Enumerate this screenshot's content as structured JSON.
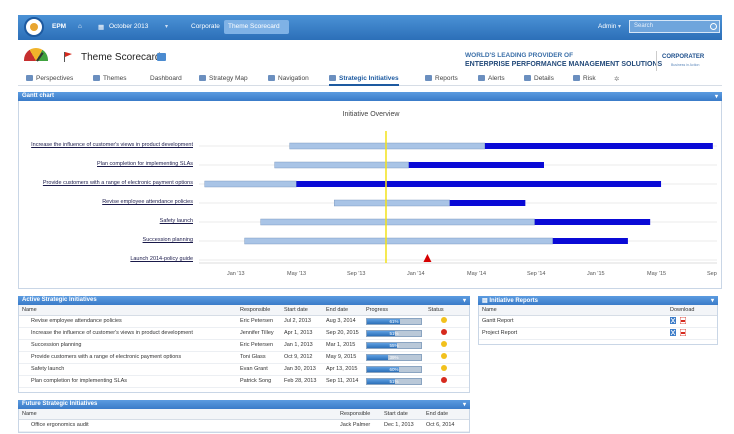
{
  "topbar": {
    "app": "EPM",
    "period": "October 2013",
    "org": "Corporate",
    "view": "Theme Scorecard",
    "user": "Admin",
    "search_placeholder": "Search"
  },
  "header": {
    "title": "Theme Scorecard",
    "banner_line1": "WORLD'S LEADING PROVIDER OF",
    "banner_line2": "ENTERPRISE PERFORMANCE MANAGEMENT SOLUTIONS",
    "logo_main": "CORPORATER",
    "logo_sub": "Business in Action"
  },
  "nav": {
    "tabs": [
      {
        "label": "Perspectives",
        "icon": "perspectives-icon"
      },
      {
        "label": "Themes",
        "icon": "themes-icon"
      },
      {
        "label": "Dashboard",
        "icon": ""
      },
      {
        "label": "Strategy Map",
        "icon": "strategy-map-icon"
      },
      {
        "label": "Navigation",
        "icon": "navigation-icon"
      },
      {
        "label": "Strategic Initiatives",
        "icon": "list-icon",
        "active": true
      },
      {
        "label": "Reports",
        "icon": "reports-icon"
      },
      {
        "label": "Alerts",
        "icon": "alert-icon"
      },
      {
        "label": "Details",
        "icon": "details-icon"
      },
      {
        "label": "Risk",
        "icon": "risk-icon"
      }
    ]
  },
  "gantt": {
    "panel_title": "Gantt chart",
    "subtitle": "Initiative Overview",
    "rows": [
      {
        "label": "Increase the influence of customer's views in product development",
        "start": 0.175,
        "split": 0.552,
        "end": 0.992
      },
      {
        "label": "Plan completion for implementing SLAs",
        "start": 0.146,
        "split": 0.405,
        "end": 0.666
      },
      {
        "label": "Provide customers with a range of electronic payment options",
        "start": 0.011,
        "split": 0.188,
        "end": 0.892
      },
      {
        "label": "Revise employee attendance policies",
        "start": 0.261,
        "split": 0.484,
        "end": 0.63
      },
      {
        "label": "Safety launch",
        "start": 0.119,
        "split": 0.648,
        "end": 0.871
      },
      {
        "label": "Succession planning",
        "start": 0.088,
        "split": 0.683,
        "end": 0.828
      },
      {
        "label": "Launch 2014-policy guide",
        "milestone": 0.441
      }
    ],
    "today": 0.361,
    "ticks": [
      "Jan '13",
      "May '13",
      "Sep '13",
      "Jan '14",
      "May '14",
      "Sep '14",
      "Jan '15",
      "May '15",
      "Sep"
    ]
  },
  "active": {
    "panel_title": "Active Strategic Initiatives",
    "columns": [
      "Name",
      "Responsible",
      "Start date",
      "End date",
      "Progress",
      "Status"
    ],
    "rows": [
      {
        "name": "Revise employee attendance policies",
        "resp": "Eric Petersen",
        "start": "Jul 2, 2013",
        "end": "Aug 3, 2014",
        "progress": 0.61,
        "ptext": "61%",
        "status": "yellow"
      },
      {
        "name": "Increase the influence of customer's views in product development",
        "resp": "Jennifer Tilley",
        "start": "Apr 1, 2013",
        "end": "Sep 20, 2015",
        "progress": 0.51,
        "ptext": "51%",
        "status": "red"
      },
      {
        "name": "Succession planning",
        "resp": "Eric Petersen",
        "start": "Jan 1, 2013",
        "end": "Mar 1, 2015",
        "progress": 0.55,
        "ptext": "55%",
        "status": "yellow"
      },
      {
        "name": "Provide customers with a range of electronic payment options",
        "resp": "Toni Glass",
        "start": "Oct 9, 2012",
        "end": "May 9, 2015",
        "progress": 0.39,
        "ptext": "39%",
        "status": "yellow"
      },
      {
        "name": "Safety launch",
        "resp": "Evan Grant",
        "start": "Jan 30, 2013",
        "end": "Apr 13, 2015",
        "progress": 0.6,
        "ptext": "60%",
        "status": "yellow"
      },
      {
        "name": "Plan completion for implementing SLAs",
        "resp": "Patrick Song",
        "start": "Feb 28, 2013",
        "end": "Sep 11, 2014",
        "progress": 0.51,
        "ptext": "51%",
        "status": "red"
      }
    ]
  },
  "reports": {
    "panel_title": "Initiative Reports",
    "columns": [
      "Name",
      "Download"
    ],
    "rows": [
      {
        "name": "Gantt Report"
      },
      {
        "name": "Project Report"
      }
    ]
  },
  "future": {
    "panel_title": "Future Strategic Initiatives",
    "columns": [
      "Name",
      "Responsible",
      "Start date",
      "End date"
    ],
    "rows": [
      {
        "name": "Office ergonomics audit",
        "resp": "Jack Palmer",
        "start": "Dec 1, 2013",
        "end": "Oct 6, 2014"
      }
    ]
  },
  "colors": {
    "bar_light": "#a9c4e6",
    "bar_dark": "#0a0ad6",
    "today_line": "#f2e21a",
    "milestone": "#d60000",
    "status_yellow": "#f2c11d",
    "status_red": "#d62a1e"
  }
}
